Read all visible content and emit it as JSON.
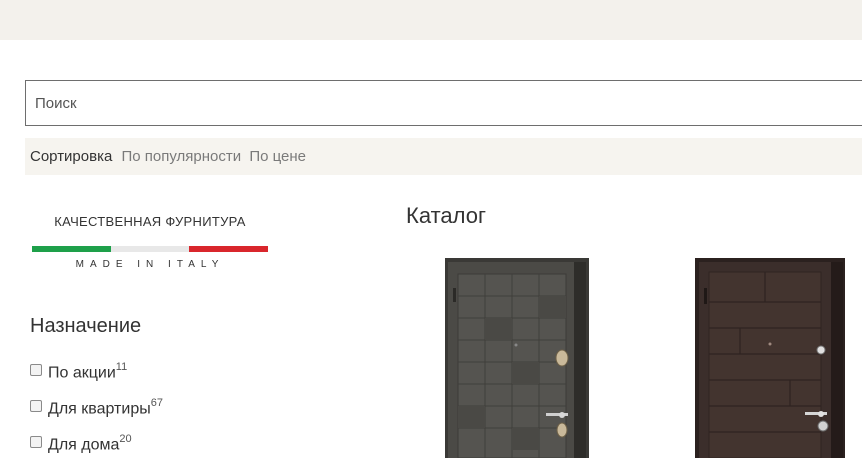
{
  "search": {
    "placeholder": "Поиск"
  },
  "sort": {
    "label": "Сортировка",
    "options": [
      "По популярности",
      "По цене"
    ]
  },
  "brand": {
    "title": "КАЧЕСТВЕННАЯ ФУРНИТУРА",
    "subtitle": "MADE IN ITALY"
  },
  "filter": {
    "title": "Назначение",
    "items": [
      {
        "label": "По акции",
        "count": "11"
      },
      {
        "label": "Для квартиры",
        "count": "67"
      },
      {
        "label": "Для дома",
        "count": "20"
      }
    ]
  },
  "catalog": {
    "title": "Каталог"
  },
  "colors": {
    "flag_green": "#1ea04a",
    "flag_white": "#e8e8e8",
    "flag_red": "#d9262c"
  }
}
